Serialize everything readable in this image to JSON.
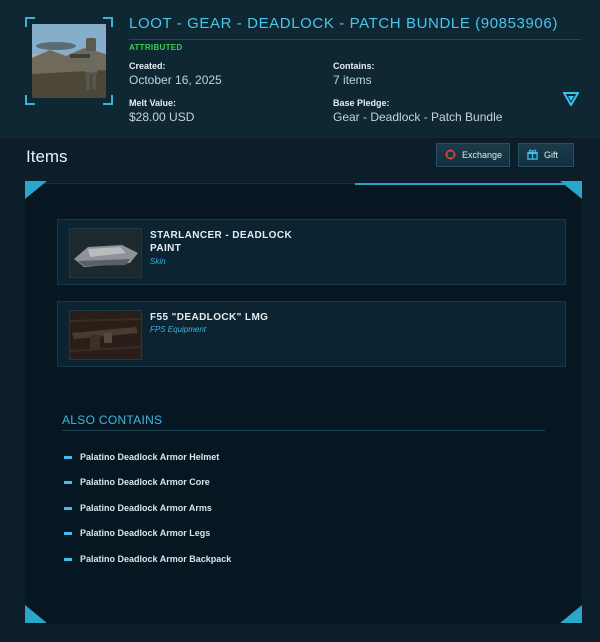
{
  "pledge": {
    "title": "LOOT - GEAR - DEADLOCK - PATCH BUNDLE (90853906)",
    "status": "ATTRIBUTED",
    "created_label": "Created:",
    "created_value": "October 16, 2025",
    "contains_label": "Contains:",
    "contains_value": "7 items",
    "melt_label": "Melt Value:",
    "melt_value": "$28.00 USD",
    "base_label": "Base Pledge:",
    "base_value": "Gear - Deadlock - Patch Bundle",
    "toggle_icon": "chevron-down-icon"
  },
  "items_section": {
    "heading": "Items",
    "exchange_label": "Exchange",
    "gift_label": "Gift",
    "exchange_icon": "exchange-icon",
    "gift_icon": "gift-icon"
  },
  "items": [
    {
      "name": "STARLANCER - DEADLOCK PAINT",
      "type": "Skin"
    },
    {
      "name": "F55 \"DEADLOCK\" LMG",
      "type": "FPS Equipment"
    }
  ],
  "also_contains": {
    "title": "ALSO CONTAINS",
    "items": [
      "Palatino Deadlock Armor Helmet",
      "Palatino Deadlock Armor Core",
      "Palatino Deadlock Armor Arms",
      "Palatino Deadlock Armor Legs",
      "Palatino Deadlock Armor Backpack"
    ]
  },
  "colors": {
    "accent": "#3fb8e3",
    "status_green": "#34d24a",
    "background": "#0b1e29"
  }
}
